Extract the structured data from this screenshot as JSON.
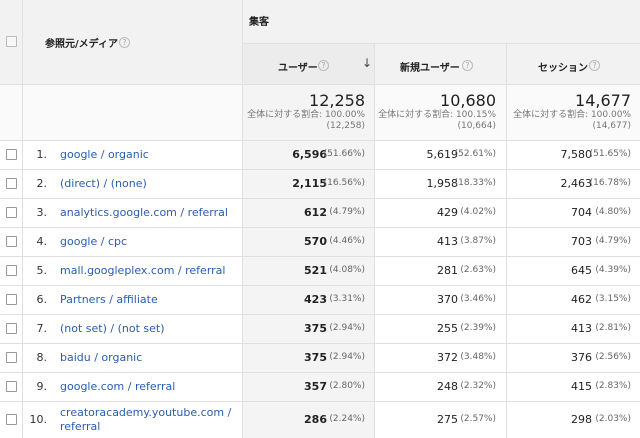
{
  "header": {
    "group_label": "集客",
    "source_medium": "参照元/メディア",
    "users": "ユーザー",
    "new_users": "新規ユーザー",
    "sessions": "セッション",
    "help_glyph": "?",
    "sort_glyph": "↓"
  },
  "totals": {
    "users": {
      "value": "12,258",
      "line1": "全体に対する割合: 100.00%",
      "line2": "(12,258)"
    },
    "new_users": {
      "value": "10,680",
      "line1": "全体に対する割合: 100.15%",
      "line2": "(10,664)"
    },
    "sessions": {
      "value": "14,677",
      "line1": "全体に対する割合: 100.00%",
      "line2": "(14,677)"
    }
  },
  "rows": [
    {
      "idx": "1.",
      "source": "google / organic",
      "source2": "",
      "users": "6,596",
      "users_pct": "(51.66%)",
      "new_users": "5,619",
      "new_users_pct": "(52.61%)",
      "sessions": "7,580",
      "sessions_pct": "(51.65%)"
    },
    {
      "idx": "2.",
      "source": "(direct) / (none)",
      "source2": "",
      "users": "2,115",
      "users_pct": "(16.56%)",
      "new_users": "1,958",
      "new_users_pct": "(18.33%)",
      "sessions": "2,463",
      "sessions_pct": "(16.78%)"
    },
    {
      "idx": "3.",
      "source": "analytics.google.com / referral",
      "source2": "",
      "users": "612",
      "users_pct": "(4.79%)",
      "new_users": "429",
      "new_users_pct": "(4.02%)",
      "sessions": "704",
      "sessions_pct": "(4.80%)"
    },
    {
      "idx": "4.",
      "source": "google / cpc",
      "source2": "",
      "users": "570",
      "users_pct": "(4.46%)",
      "new_users": "413",
      "new_users_pct": "(3.87%)",
      "sessions": "703",
      "sessions_pct": "(4.79%)"
    },
    {
      "idx": "5.",
      "source": "mall.googleplex.com / referral",
      "source2": "",
      "users": "521",
      "users_pct": "(4.08%)",
      "new_users": "281",
      "new_users_pct": "(2.63%)",
      "sessions": "645",
      "sessions_pct": "(4.39%)"
    },
    {
      "idx": "6.",
      "source": "Partners / affiliate",
      "source2": "",
      "users": "423",
      "users_pct": "(3.31%)",
      "new_users": "370",
      "new_users_pct": "(3.46%)",
      "sessions": "462",
      "sessions_pct": "(3.15%)"
    },
    {
      "idx": "7.",
      "source": "(not set) / (not set)",
      "source2": "",
      "users": "375",
      "users_pct": "(2.94%)",
      "new_users": "255",
      "new_users_pct": "(2.39%)",
      "sessions": "413",
      "sessions_pct": "(2.81%)"
    },
    {
      "idx": "8.",
      "source": "baidu / organic",
      "source2": "",
      "users": "375",
      "users_pct": "(2.94%)",
      "new_users": "372",
      "new_users_pct": "(3.48%)",
      "sessions": "376",
      "sessions_pct": "(2.56%)"
    },
    {
      "idx": "9.",
      "source": "google.com / referral",
      "source2": "",
      "users": "357",
      "users_pct": "(2.80%)",
      "new_users": "248",
      "new_users_pct": "(2.32%)",
      "sessions": "415",
      "sessions_pct": "(2.83%)"
    },
    {
      "idx": "10.",
      "source": "creatoracademy.youtube.com /",
      "source2": "referral",
      "users": "286",
      "users_pct": "(2.24%)",
      "new_users": "275",
      "new_users_pct": "(2.57%)",
      "sessions": "298",
      "sessions_pct": "(2.03%)"
    }
  ]
}
